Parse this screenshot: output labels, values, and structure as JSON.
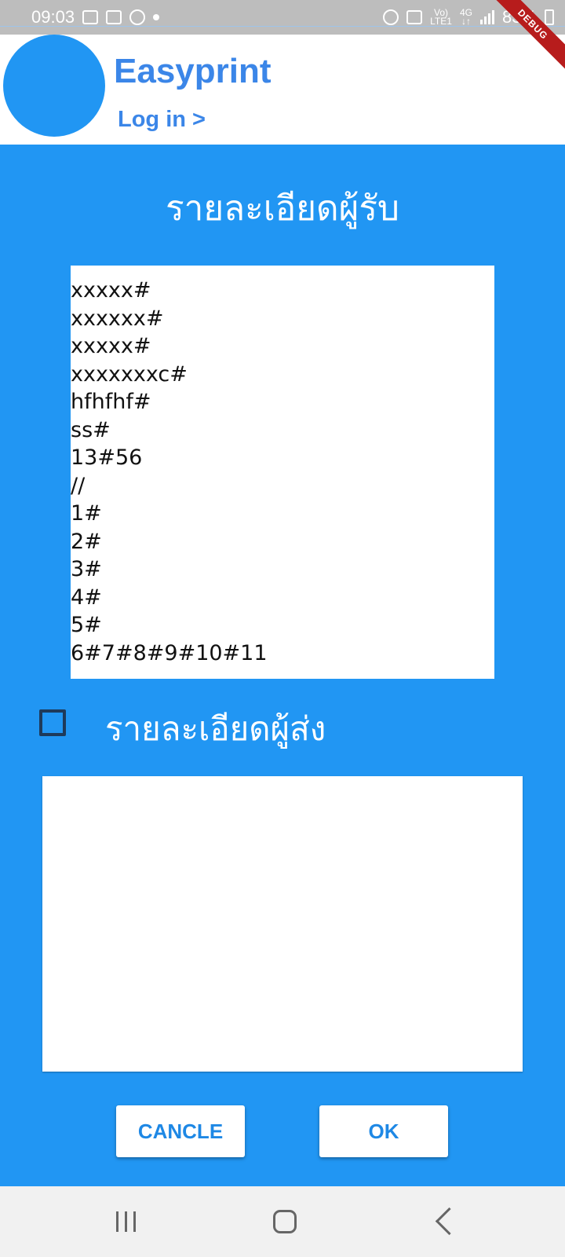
{
  "status_bar": {
    "time": "09:03",
    "network_top": "Vo)",
    "network_bottom": "LTE1",
    "mobile_top": "4G",
    "battery": "83%"
  },
  "debug_banner": "DEBUG",
  "header": {
    "app_title": "Easyprint",
    "login_link": "Log in >"
  },
  "recipient": {
    "title": "รายละเอียดผู้รับ",
    "lines": [
      "xxxxx#",
      "xxxxxx#",
      "xxxxx#",
      "xxxxxxxc#",
      "hfhfhf#",
      "ss#",
      "13#56",
      "//",
      "1#",
      "2#",
      "3#",
      "4#",
      "5#",
      "6#7#8#9#10#11"
    ]
  },
  "sender": {
    "label": "รายละเอียดผู้ส่ง",
    "checked": false
  },
  "buttons": {
    "cancel": "CANCLE",
    "ok": "OK"
  }
}
